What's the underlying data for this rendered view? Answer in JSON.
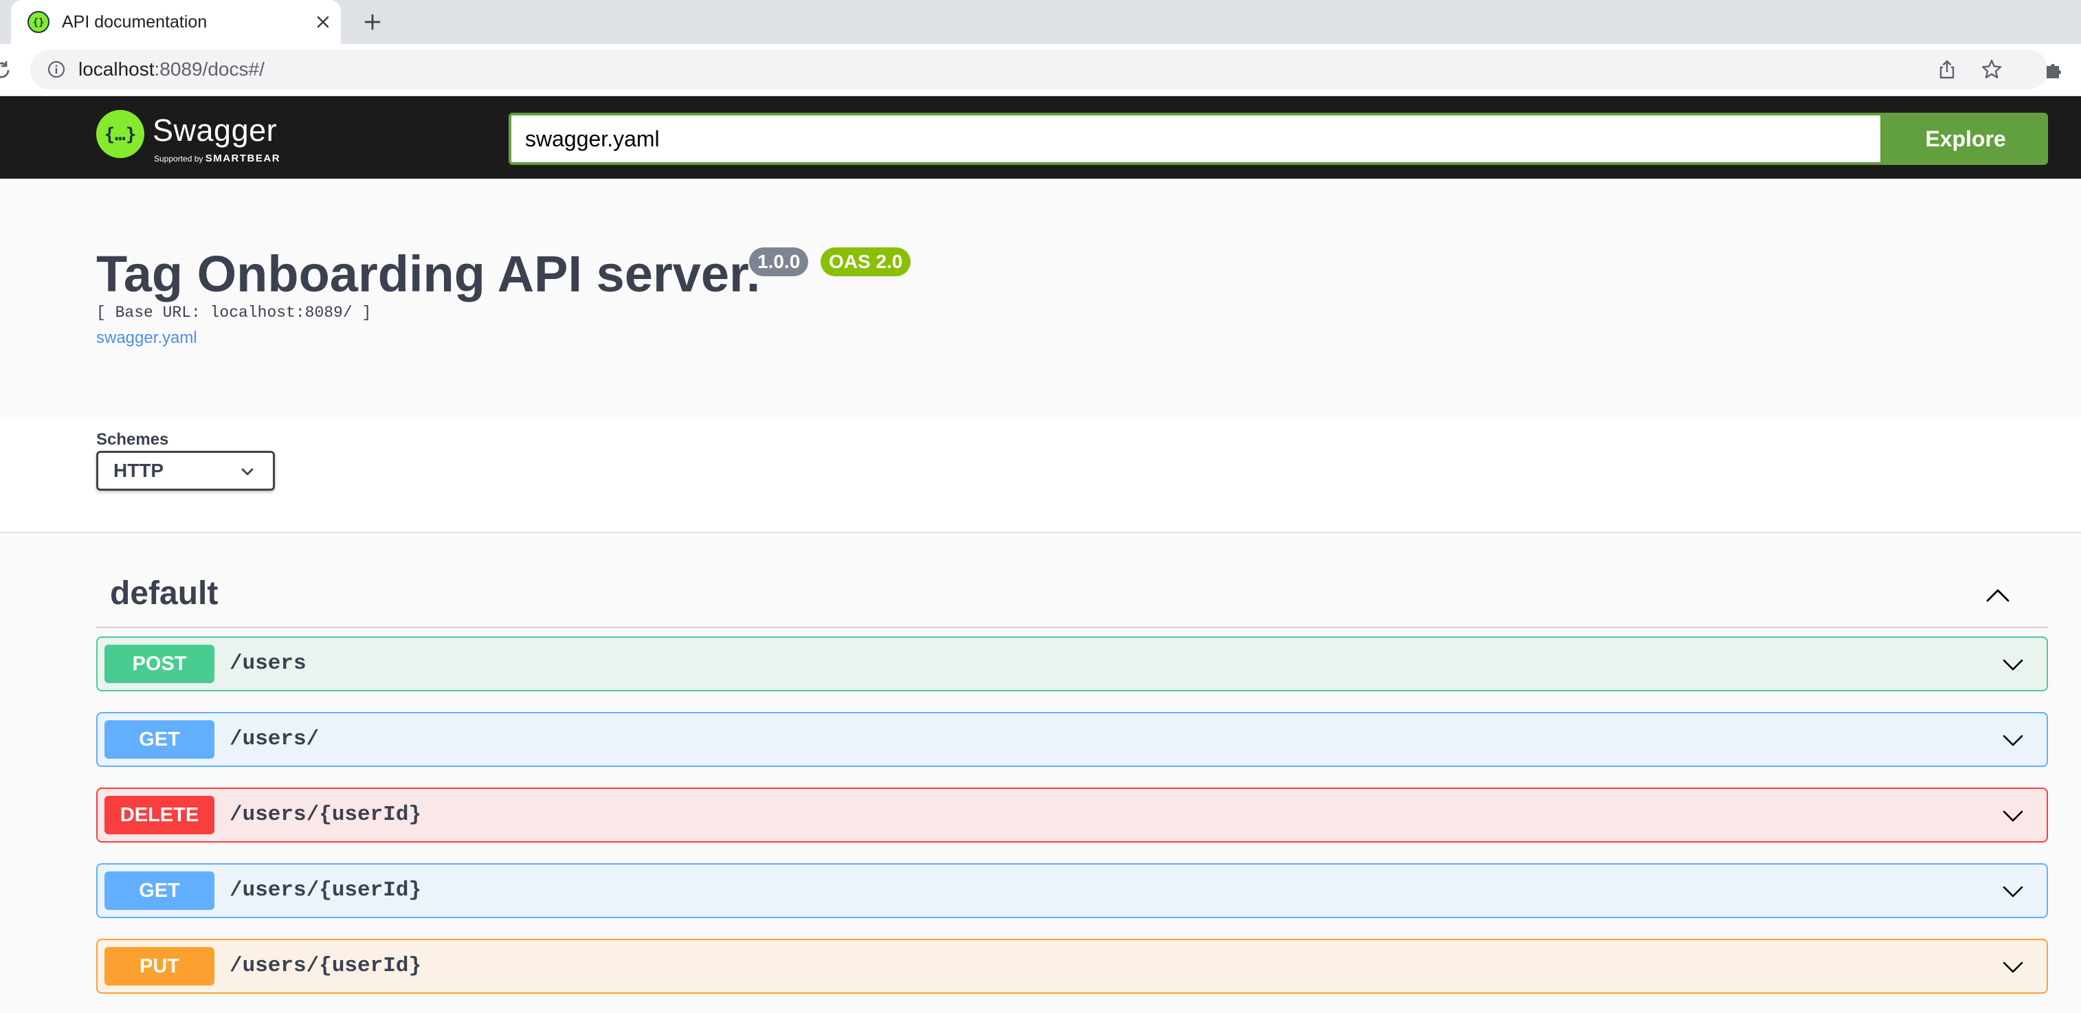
{
  "browser": {
    "tab_title": "API documentation",
    "url_host": "localhost",
    "url_path": ":8089/docs#/"
  },
  "topbar": {
    "logo_text": "Swagger",
    "logo_sub_prefix": "Supported by ",
    "logo_sub_brand": "SMARTBEAR",
    "spec_input_value": "swagger.yaml",
    "explore_label": "Explore",
    "accent_color": "#62a03f"
  },
  "info": {
    "title": "Tag Onboarding API server.",
    "version_badge": "1.0.0",
    "oas_badge": "OAS 2.0",
    "base_url": "[ Base URL: localhost:8089/ ]",
    "spec_link": "swagger.yaml"
  },
  "schemes": {
    "label": "Schemes",
    "selected": "HTTP"
  },
  "tag": {
    "name": "default",
    "expanded": true
  },
  "operations": [
    {
      "method": "POST",
      "path": "/users",
      "color": "#49cc90"
    },
    {
      "method": "GET",
      "path": "/users/",
      "color": "#61affe"
    },
    {
      "method": "DELETE",
      "path": "/users/{userId}",
      "color": "#f93e3e"
    },
    {
      "method": "GET",
      "path": "/users/{userId}",
      "color": "#61affe"
    },
    {
      "method": "PUT",
      "path": "/users/{userId}",
      "color": "#fca130"
    }
  ]
}
